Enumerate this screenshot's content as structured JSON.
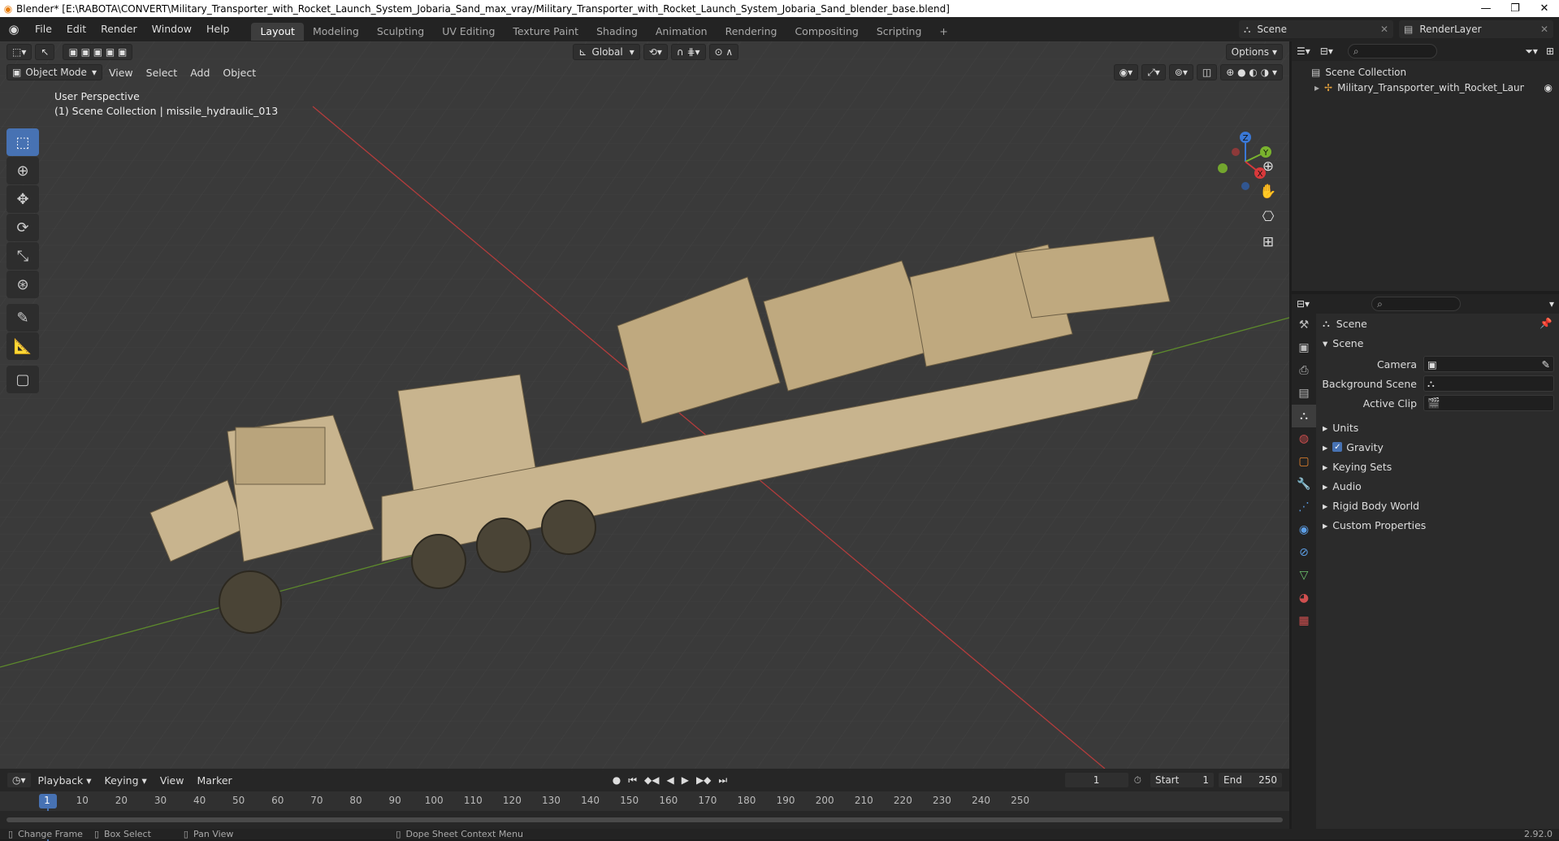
{
  "titlebar": {
    "title": "Blender* [E:\\RABOTA\\CONVERT\\Military_Transporter_with_Rocket_Launch_System_Jobaria_Sand_max_vray/Military_Transporter_with_Rocket_Launch_System_Jobaria_Sand_blender_base.blend]",
    "minimize": "—",
    "maximize": "❐",
    "close": "✕"
  },
  "menu": [
    "File",
    "Edit",
    "Render",
    "Window",
    "Help"
  ],
  "workspaces": [
    "Layout",
    "Modeling",
    "Sculpting",
    "UV Editing",
    "Texture Paint",
    "Shading",
    "Animation",
    "Rendering",
    "Compositing",
    "Scripting"
  ],
  "add_workspace": "+",
  "scene_selector": "Scene",
  "renderlayer_selector": "RenderLayer",
  "viewport": {
    "transform_orientation": "Global",
    "options_label": "Options",
    "mode": "Object Mode",
    "menus": [
      "View",
      "Select",
      "Add",
      "Object"
    ],
    "info_line1": "User Perspective",
    "info_line2": "(1) Scene Collection | missile_hydraulic_013",
    "gizmo_axes": [
      "Z",
      "Y",
      "X"
    ]
  },
  "outliner": {
    "root": "Scene Collection",
    "items": [
      "Military_Transporter_with_Rocket_Launch_S"
    ]
  },
  "properties": {
    "header": "Scene",
    "panel": "Scene",
    "camera_label": "Camera",
    "background_scene_label": "Background Scene",
    "active_clip_label": "Active Clip",
    "sections": [
      "Units",
      "Gravity",
      "Keying Sets",
      "Audio",
      "Rigid Body World",
      "Custom Properties"
    ],
    "gravity_checked": true
  },
  "timeline": {
    "menus": [
      "Playback",
      "Keying",
      "View",
      "Marker"
    ],
    "current_frame": "1",
    "start_label": "Start",
    "start_value": "1",
    "end_label": "End",
    "end_value": "250",
    "ruler_ticks": [
      "1",
      "10",
      "20",
      "30",
      "40",
      "50",
      "60",
      "70",
      "80",
      "90",
      "100",
      "110",
      "120",
      "130",
      "140",
      "150",
      "160",
      "170",
      "180",
      "190",
      "200",
      "210",
      "220",
      "230",
      "240",
      "250"
    ]
  },
  "statusbar": {
    "items": [
      "Change Frame",
      "Box Select",
      "Pan View",
      "Dope Sheet Context Menu"
    ],
    "version": "2.92.0"
  }
}
